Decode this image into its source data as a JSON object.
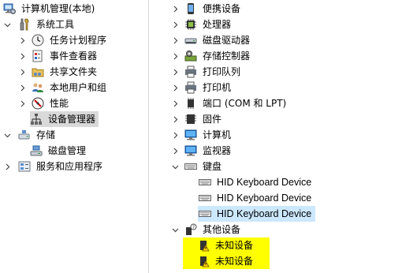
{
  "left_tree": {
    "root": "计算机管理(本地)",
    "system_tools": "系统工具",
    "task_scheduler": "任务计划程序",
    "event_viewer": "事件查看器",
    "shared_folders": "共享文件夹",
    "local_users": "本地用户和组",
    "performance": "性能",
    "device_manager": "设备管理器",
    "storage": "存储",
    "disk_management": "磁盘管理",
    "services_apps": "服务和应用程序"
  },
  "device_tree": {
    "portable": "便携设备",
    "processor": "处理器",
    "disk_drives": "磁盘驱动器",
    "storage_controllers": "存储控制器",
    "print_queues": "打印队列",
    "printers": "打印机",
    "ports": "端口 (COM 和 LPT)",
    "firmware": "固件",
    "computer": "计算机",
    "monitors": "监视器",
    "keyboards": "键盘",
    "hid1": "HID Keyboard Device",
    "hid2": "HID Keyboard Device",
    "hid3": "HID Keyboard Device",
    "other_devices": "其他设备",
    "unknown1": "未知设备",
    "unknown2": "未知设备"
  },
  "colors": {
    "selection_gray": "#d9d9d9",
    "selection_blue": "#cce8ff",
    "highlight_yellow": "#ffff00"
  }
}
